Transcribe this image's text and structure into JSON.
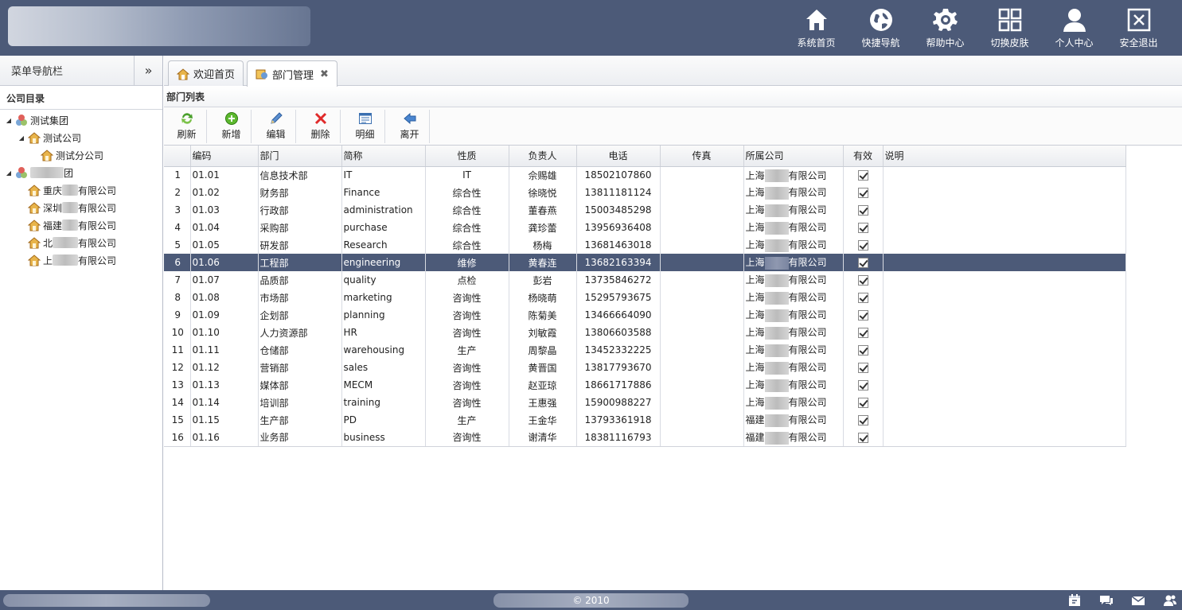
{
  "header": {
    "nav": [
      {
        "label": "系统首页",
        "icon": "home-icon"
      },
      {
        "label": "快捷导航",
        "icon": "globe-icon"
      },
      {
        "label": "帮助中心",
        "icon": "gear-icon"
      },
      {
        "label": "切换皮肤",
        "icon": "grid-icon"
      },
      {
        "label": "个人中心",
        "icon": "user-icon"
      },
      {
        "label": "安全退出",
        "icon": "exit-icon"
      }
    ]
  },
  "sidebar": {
    "title": "菜单导航栏",
    "collapse": "»",
    "section": "公司目录",
    "tree": [
      {
        "label": "测试集团",
        "level": 0,
        "expanded": true,
        "icon": "group-icon"
      },
      {
        "label": "测试公司",
        "level": 1,
        "expanded": true,
        "icon": "company-icon"
      },
      {
        "label": "测试分公司",
        "level": 2,
        "icon": "company-icon"
      },
      {
        "label": "团",
        "level": 0,
        "expanded": true,
        "icon": "group-icon"
      },
      {
        "label": "重庆",
        "suffix": "有限公司",
        "level": 1,
        "icon": "company-icon"
      },
      {
        "label": "深圳",
        "suffix": "有限公司",
        "level": 1,
        "icon": "company-icon"
      },
      {
        "label": "福建",
        "suffix": "有限公司",
        "level": 1,
        "icon": "company-icon"
      },
      {
        "label": "北",
        "suffix": "有限公司",
        "level": 1,
        "icon": "company-icon"
      },
      {
        "label": "上",
        "suffix": "有限公司",
        "level": 1,
        "icon": "company-icon"
      }
    ]
  },
  "tabs": [
    {
      "label": "欢迎首页",
      "icon": "home-icon",
      "closable": false,
      "active": false
    },
    {
      "label": "部门管理",
      "icon": "department-icon",
      "closable": true,
      "active": true
    }
  ],
  "main": {
    "title": "部门列表",
    "toolbar": [
      {
        "label": "刷新",
        "icon": "refresh-icon"
      },
      {
        "label": "新增",
        "icon": "add-icon"
      },
      {
        "label": "编辑",
        "icon": "edit-icon"
      },
      {
        "label": "删除",
        "icon": "delete-icon"
      },
      {
        "label": "明细",
        "icon": "detail-icon"
      },
      {
        "label": "离开",
        "icon": "back-icon"
      }
    ],
    "columns": [
      "",
      "编码",
      "部门",
      "简称",
      "性质",
      "负责人",
      "电话",
      "传真",
      "所属公司",
      "有效",
      "说明"
    ],
    "selected_row": 6,
    "rows": [
      {
        "n": "1",
        "code": "01.01",
        "dept": "信息技术部",
        "abbr": "IT",
        "type": "IT",
        "head": "佘赐雄",
        "phone": "18502107860",
        "fax": "",
        "co1": "上海",
        "co2": "有限公司",
        "valid": true,
        "note": ""
      },
      {
        "n": "2",
        "code": "01.02",
        "dept": "财务部",
        "abbr": "Finance",
        "type": "综合性",
        "head": "徐晓悦",
        "phone": "13811181124",
        "fax": "",
        "co1": "上海",
        "co2": "有限公司",
        "valid": true,
        "note": ""
      },
      {
        "n": "3",
        "code": "01.03",
        "dept": "行政部",
        "abbr": "administration",
        "type": "综合性",
        "head": "董春燕",
        "phone": "15003485298",
        "fax": "",
        "co1": "上海",
        "co2": "有限公司",
        "valid": true,
        "note": ""
      },
      {
        "n": "4",
        "code": "01.04",
        "dept": "采购部",
        "abbr": "purchase",
        "type": "综合性",
        "head": "龚珍蕾",
        "phone": "13956936408",
        "fax": "",
        "co1": "上海",
        "co2": "有限公司",
        "valid": true,
        "note": ""
      },
      {
        "n": "5",
        "code": "01.05",
        "dept": "研发部",
        "abbr": "Research",
        "type": "综合性",
        "head": "杨梅",
        "phone": "13681463018",
        "fax": "",
        "co1": "上海",
        "co2": "有限公司",
        "valid": true,
        "note": ""
      },
      {
        "n": "6",
        "code": "01.06",
        "dept": "工程部",
        "abbr": "engineering",
        "type": "维修",
        "head": "黄春连",
        "phone": "13682163394",
        "fax": "",
        "co1": "上海",
        "co2": "有限公司",
        "valid": true,
        "note": ""
      },
      {
        "n": "7",
        "code": "01.07",
        "dept": "品质部",
        "abbr": "quality",
        "type": "点检",
        "head": "彭岩",
        "phone": "13735846272",
        "fax": "",
        "co1": "上海",
        "co2": "有限公司",
        "valid": true,
        "note": ""
      },
      {
        "n": "8",
        "code": "01.08",
        "dept": "市场部",
        "abbr": "marketing",
        "type": "咨询性",
        "head": "杨晓萌",
        "phone": "15295793675",
        "fax": "",
        "co1": "上海",
        "co2": "有限公司",
        "valid": true,
        "note": ""
      },
      {
        "n": "9",
        "code": "01.09",
        "dept": "企划部",
        "abbr": "planning",
        "type": "咨询性",
        "head": "陈菊美",
        "phone": "13466664090",
        "fax": "",
        "co1": "上海",
        "co2": "有限公司",
        "valid": true,
        "note": ""
      },
      {
        "n": "10",
        "code": "01.10",
        "dept": "人力资源部",
        "abbr": "HR",
        "type": "咨询性",
        "head": "刘敏霞",
        "phone": "13806603588",
        "fax": "",
        "co1": "上海",
        "co2": "有限公司",
        "valid": true,
        "note": ""
      },
      {
        "n": "11",
        "code": "01.11",
        "dept": "仓储部",
        "abbr": "warehousing",
        "type": "生产",
        "head": "周黎晶",
        "phone": "13452332225",
        "fax": "",
        "co1": "上海",
        "co2": "有限公司",
        "valid": true,
        "note": ""
      },
      {
        "n": "12",
        "code": "01.12",
        "dept": "营销部",
        "abbr": "sales",
        "type": "咨询性",
        "head": "黄晋国",
        "phone": "13817793670",
        "fax": "",
        "co1": "上海",
        "co2": "有限公司",
        "valid": true,
        "note": ""
      },
      {
        "n": "13",
        "code": "01.13",
        "dept": "媒体部",
        "abbr": "MECM",
        "type": "咨询性",
        "head": "赵亚琼",
        "phone": "18661717886",
        "fax": "",
        "co1": "上海",
        "co2": "有限公司",
        "valid": true,
        "note": ""
      },
      {
        "n": "14",
        "code": "01.14",
        "dept": "培训部",
        "abbr": "training",
        "type": "咨询性",
        "head": "王惠强",
        "phone": "15900988227",
        "fax": "",
        "co1": "上海",
        "co2": "有限公司",
        "valid": true,
        "note": ""
      },
      {
        "n": "15",
        "code": "01.15",
        "dept": "生产部",
        "abbr": "PD",
        "type": "生产",
        "head": "王金华",
        "phone": "13793361918",
        "fax": "",
        "co1": "福建",
        "co2": "有限公司",
        "valid": true,
        "note": ""
      },
      {
        "n": "16",
        "code": "01.16",
        "dept": "业务部",
        "abbr": "business",
        "type": "咨询性",
        "head": "谢清华",
        "phone": "18381116793",
        "fax": "",
        "co1": "福建",
        "co2": "有限公司",
        "valid": true,
        "note": ""
      }
    ]
  },
  "footer": {
    "copyright": "© 2010",
    "icons": [
      "calendar-icon",
      "chat-icon",
      "mail-icon",
      "users-icon"
    ]
  },
  "colors": {
    "theme": "#4c5a78",
    "selected_row": "#4c5a78"
  }
}
